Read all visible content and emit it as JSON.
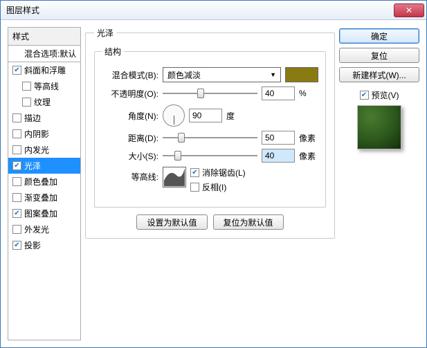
{
  "window": {
    "title": "图层样式"
  },
  "left": {
    "header": "样式",
    "items": [
      {
        "label": "混合选项:默认",
        "checkbox": false,
        "checked": false,
        "mix": true
      },
      {
        "label": "斜面和浮雕",
        "checkbox": true,
        "checked": true
      },
      {
        "label": "等高线",
        "checkbox": true,
        "checked": false,
        "indent": true
      },
      {
        "label": "纹理",
        "checkbox": true,
        "checked": false,
        "indent": true
      },
      {
        "label": "描边",
        "checkbox": true,
        "checked": false
      },
      {
        "label": "内阴影",
        "checkbox": true,
        "checked": false
      },
      {
        "label": "内发光",
        "checkbox": true,
        "checked": false
      },
      {
        "label": "光泽",
        "checkbox": true,
        "checked": true,
        "selected": true
      },
      {
        "label": "颜色叠加",
        "checkbox": true,
        "checked": false
      },
      {
        "label": "渐变叠加",
        "checkbox": true,
        "checked": false
      },
      {
        "label": "图案叠加",
        "checkbox": true,
        "checked": true
      },
      {
        "label": "外发光",
        "checkbox": true,
        "checked": false
      },
      {
        "label": "投影",
        "checkbox": true,
        "checked": true
      }
    ]
  },
  "center": {
    "group_title": "光泽",
    "struct_title": "结构",
    "labels": {
      "blend_mode": "混合模式(B):",
      "opacity": "不透明度(O):",
      "angle": "角度(N):",
      "distance": "距离(D):",
      "size": "大小(S):",
      "contour": "等高线:"
    },
    "blend_mode_value": "颜色减淡",
    "color_swatch": "#8a7a12",
    "opacity": "40",
    "opacity_unit": "%",
    "angle": "90",
    "angle_unit": "度",
    "distance": "50",
    "distance_unit": "像素",
    "size": "40",
    "size_unit": "像素",
    "antialias_label": "消除锯齿(L)",
    "antialias_checked": true,
    "invert_label": "反相(I)",
    "invert_checked": false,
    "btn_default": "设置为默认值",
    "btn_reset": "复位为默认值"
  },
  "right": {
    "ok": "确定",
    "reset": "复位",
    "new_style": "新建样式(W)...",
    "preview_label": "预览(V)",
    "preview_checked": true
  }
}
